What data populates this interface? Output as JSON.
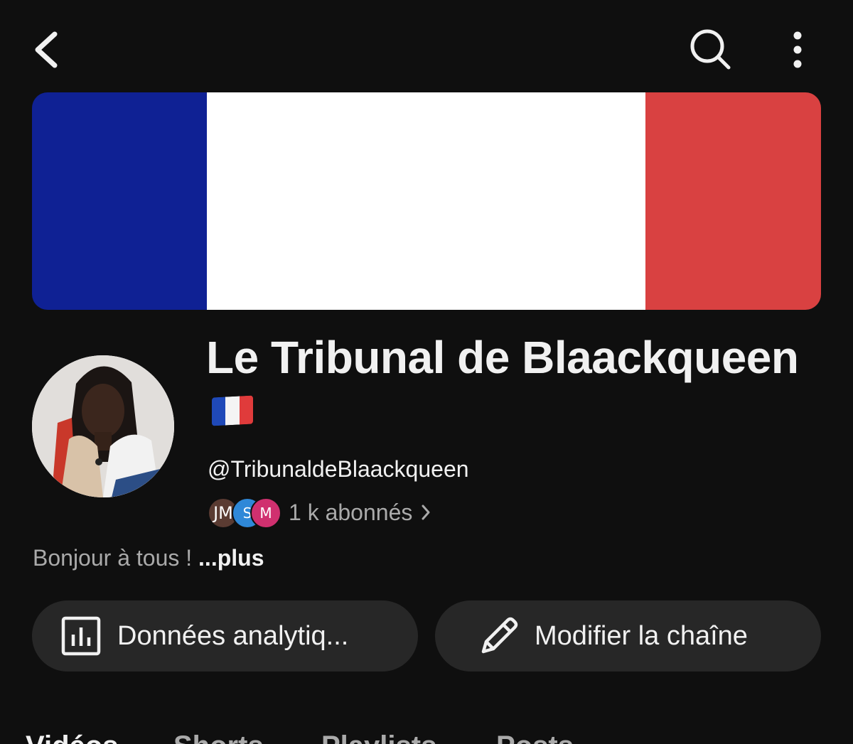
{
  "top_bar": {
    "back_icon": "chevron-left-icon",
    "search_icon": "search-icon",
    "more_icon": "more-vertical-icon"
  },
  "banner": {
    "description": "French flag banner",
    "colors": [
      "#0f2194",
      "#ffffff",
      "#d94141"
    ]
  },
  "channel": {
    "title": "Le Tribunal de Blaackqueen",
    "title_emoji": "🇫🇷",
    "handle": "@TribunaldeBlaackqueen",
    "subscribers_label": "1 k abonnés",
    "subscriber_avatars": [
      {
        "initials": "JM",
        "color": "#5a3b32"
      },
      {
        "initials": "S",
        "color": "#2f88d8"
      },
      {
        "initials": "M",
        "color": "#d0306f"
      }
    ],
    "description_text": "Bonjour à tous !",
    "description_more": "...plus"
  },
  "buttons": {
    "analytics_label": "Données analytiq...",
    "analytics_icon": "bar-chart-icon",
    "edit_label": "Modifier la chaîne",
    "edit_icon": "pencil-icon"
  },
  "tabs": [
    {
      "label": "Vidéos",
      "active": true
    },
    {
      "label": "Shorts",
      "active": false
    },
    {
      "label": "Playlists",
      "active": false
    },
    {
      "label": "Posts",
      "active": false
    }
  ],
  "colors": {
    "background": "#0f0f0f",
    "button_bg": "#272727",
    "text_primary": "#f1f1f1",
    "text_secondary": "#aaaaaa"
  }
}
